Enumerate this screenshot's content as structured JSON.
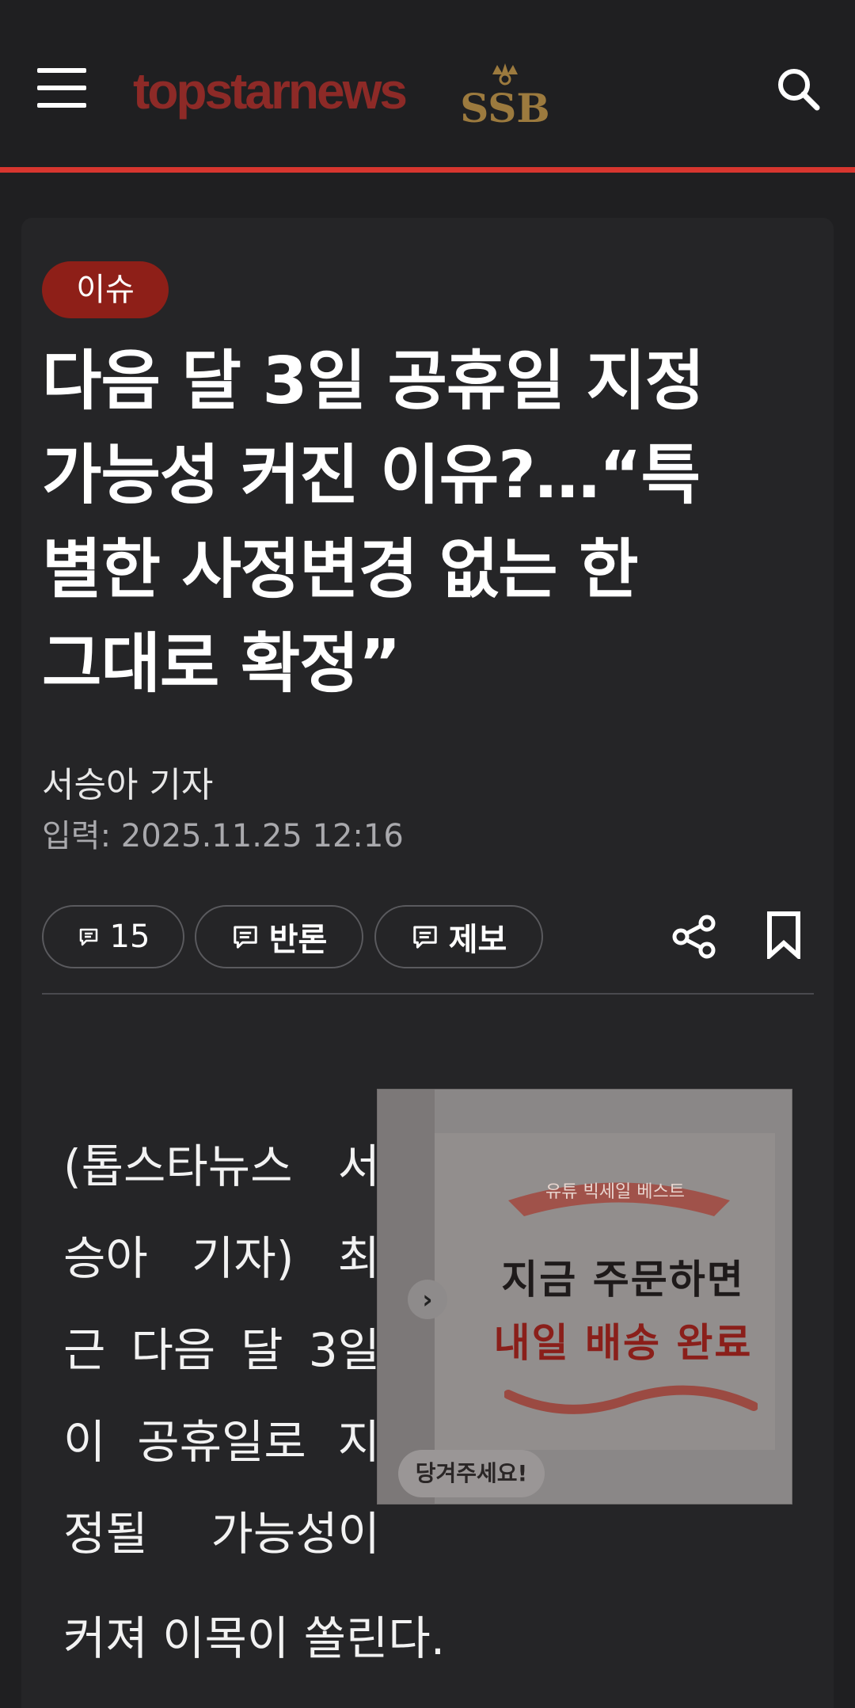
{
  "header": {
    "logo_text": "topstarnews",
    "sub_logo_text": "SSB",
    "accent_color": "#d7362f"
  },
  "article": {
    "category": "이슈",
    "headline_lines": [
      "다음 달 3일 공휴일 지정",
      "가능성 커진 이유?…“특",
      "별한 사정변경 없는 한",
      "그대로 확정”"
    ],
    "reporter": "서승아 기자",
    "published": "입력: 2025.11.25 12:16",
    "body_lines": [
      "(톱스타뉴스 서",
      "승아 기자) 최",
      "근 다음 달 3일",
      "이 공휴일로 지",
      "정될 가능성이"
    ],
    "body_last_line": "커져 이목이 쏠린다."
  },
  "actions": {
    "comment_count": "15",
    "rebut_label": "반론",
    "report_label": "제보"
  },
  "ad": {
    "ribbon_text": "유튜 빅세일 베스트",
    "line1": "지금 주문하면",
    "line2": "내일 배송 완료",
    "pull_label": "당겨주세요!"
  }
}
